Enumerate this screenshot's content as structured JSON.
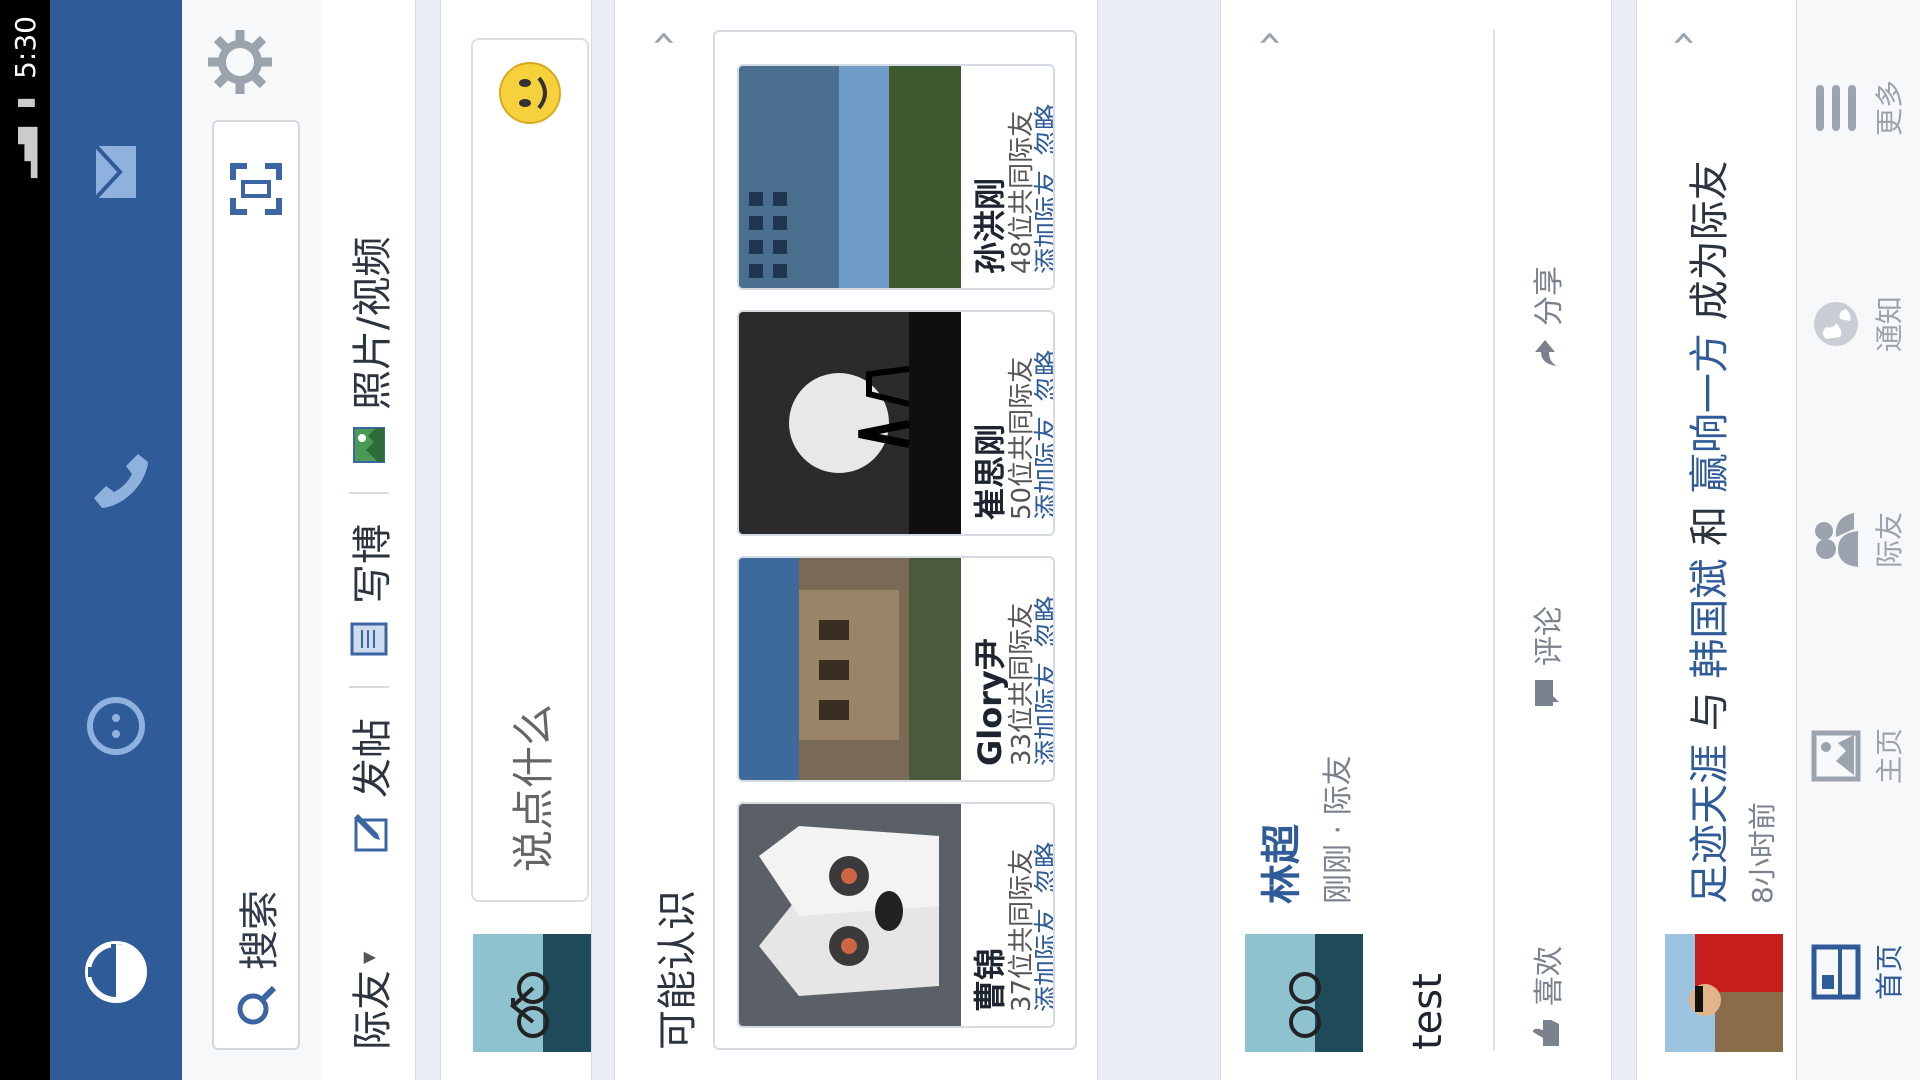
{
  "status_bar": {
    "time": "5:30"
  },
  "search": {
    "label": "搜索"
  },
  "composer": {
    "scope": "际友",
    "post": "发帖",
    "write": "写博",
    "photo": "照片/视频"
  },
  "status_input": {
    "placeholder": "说点什么"
  },
  "people_you_may_know": {
    "title": "可能认识",
    "people": [
      {
        "name": "曹锦",
        "mutual": "37位共同际友",
        "add": "添加际友",
        "ignore": "忽略"
      },
      {
        "name": "Glory尹",
        "mutual": "33位共同际友",
        "add": "添加际友",
        "ignore": "忽略"
      },
      {
        "name": "崔思刚",
        "mutual": "50位共同际友",
        "add": "添加际友",
        "ignore": "忽略"
      },
      {
        "name": "孙洪刚",
        "mutual": "48位共同际友",
        "add": "添加际友",
        "ignore": "忽略"
      }
    ]
  },
  "post": {
    "author": "林超",
    "time": "刚刚",
    "separator": "·",
    "audience": "际友",
    "body": "test",
    "actions": {
      "like": "喜欢",
      "comment": "评论",
      "share": "分享"
    }
  },
  "activity": {
    "user1": "足迹天涯",
    "with": "与",
    "user2": "韩国斌",
    "and": "和",
    "user3": "赢响一方",
    "became": "成为际友",
    "time": "8小时前"
  },
  "tabs": [
    {
      "label": "首页",
      "icon": "home-icon",
      "active": true
    },
    {
      "label": "主页",
      "icon": "profile-page-icon",
      "active": false
    },
    {
      "label": "际友",
      "icon": "friends-icon",
      "active": false
    },
    {
      "label": "通知",
      "icon": "globe-icon",
      "active": false
    },
    {
      "label": "更多",
      "icon": "menu-icon",
      "active": false
    }
  ],
  "colors": {
    "brand": "#2f5b99",
    "link": "#2f5b99",
    "background": "#e9edf3"
  }
}
